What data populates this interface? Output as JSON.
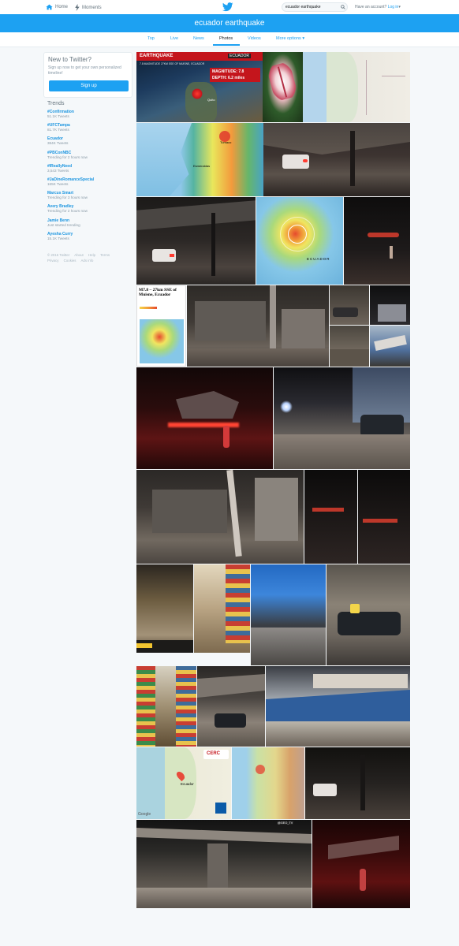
{
  "topnav": {
    "home": "Home",
    "moments": "Moments",
    "search_value": "ecuador earthquake",
    "account_prefix": "Have an account?",
    "login": "Log in"
  },
  "colors": {
    "brand": "#1da1f2",
    "link": "#1b95e0"
  },
  "banner": {
    "title": "ecuador earthquake"
  },
  "tabs": [
    "Top",
    "Live",
    "News",
    "Photos",
    "Videos",
    "More options"
  ],
  "active_tab": "Photos",
  "signup": {
    "title": "New to Twitter?",
    "description": "Sign up now to get your own personalized timeline!",
    "button": "Sign up"
  },
  "trends": {
    "title": "Trends",
    "items": [
      {
        "name": "#Confirmation",
        "meta": "51.1K Tweets"
      },
      {
        "name": "#UFCTampa",
        "meta": "81.7K Tweets"
      },
      {
        "name": "Ecuador",
        "meta": "384K Tweets"
      },
      {
        "name": "#PBConNBC",
        "meta": "Trending for 2 hours now"
      },
      {
        "name": "#IReallyNeed",
        "meta": "3,543 Tweets"
      },
      {
        "name": "#JaDineRomanceSpecial",
        "meta": "165K Tweets"
      },
      {
        "name": "Marcus Smart",
        "meta": "Trending for 3 hours now"
      },
      {
        "name": "Avery Bradley",
        "meta": "Trending for 2 hours now"
      },
      {
        "name": "Jamie Benn",
        "meta": "Just started trending"
      },
      {
        "name": "Ayesha Curry",
        "meta": "15.1K Tweets"
      }
    ]
  },
  "footer": {
    "line1": [
      "© 2016 Twitter",
      "About",
      "Help",
      "Terms"
    ],
    "line2": [
      "Privacy",
      "Cookies",
      "Ads info"
    ]
  },
  "photo_text": {
    "map_banner": "EARTHQUAKE",
    "map_region": "ECUADOR",
    "map_subline": "7.8 MAGNITUDE 27KM SSE OF MUISNE, ECUADOR",
    "magnitude": "MAGNITUDE: 7.8",
    "depth": "DEPTH: 6.2 miles",
    "map_city_1": "Tumaco",
    "map_city_2": "Esmeraldas",
    "map_city_3": "Quito",
    "usgs_country": "ECUADOR",
    "usgs_caption": "M7.8 – 27km SSE of Muisne, Ecuador",
    "cerc_logo": "CERC",
    "gmap_city": "Ecuador",
    "gmap_attr": "Google",
    "handle": "@GEO_TV"
  }
}
